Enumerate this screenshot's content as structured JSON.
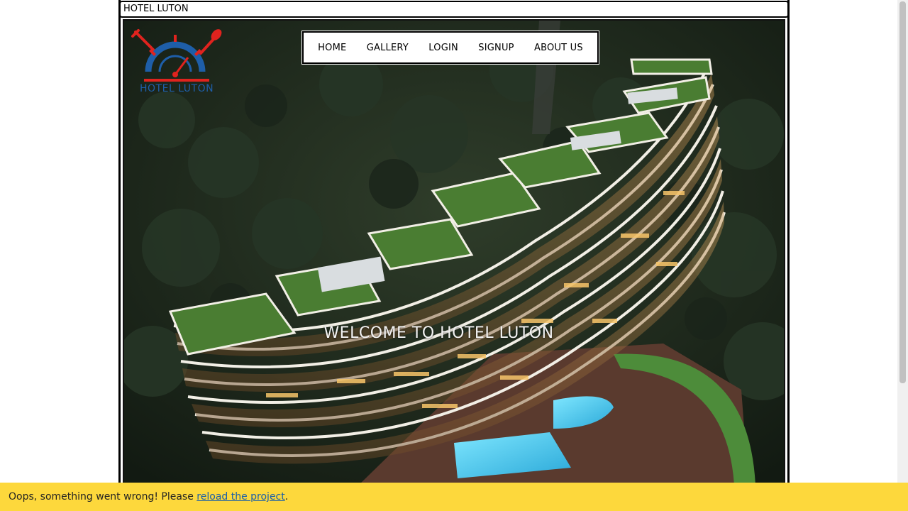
{
  "title_bar": {
    "text": "HOTEL LUTON"
  },
  "logo": {
    "text": "HOTEL LUTON"
  },
  "nav": {
    "items": [
      {
        "label": "HOME"
      },
      {
        "label": "GALLERY"
      },
      {
        "label": "LOGIN"
      },
      {
        "label": "SIGNUP"
      },
      {
        "label": "ABOUT US"
      }
    ]
  },
  "hero": {
    "image_name": "hotel-building-photo",
    "welcome": "WELCOME TO HOTEL LUTON"
  },
  "error_bar": {
    "prefix": "Oops, something went wrong! Please ",
    "link": "reload the project",
    "suffix": "."
  },
  "colors": {
    "logo_blue": "#1e5ea8",
    "logo_red": "#e0231e",
    "error_bg": "#fdd83c",
    "link": "#1a5fa8"
  }
}
